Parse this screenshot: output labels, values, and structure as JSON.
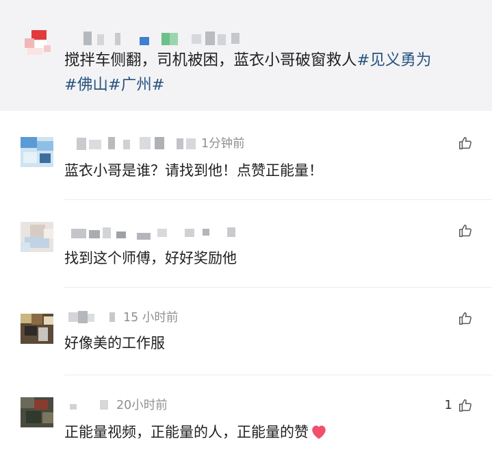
{
  "post": {
    "text_plain": "搅拌车侧翻，司机被困，蓝衣小哥破窗救人",
    "hashtags": [
      "#见义勇为",
      "#佛山",
      "#广州",
      "#"
    ]
  },
  "comments": [
    {
      "time": "1分钟前",
      "text": "蓝衣小哥是谁？请找到他！点赞正能量！",
      "likes": ""
    },
    {
      "time": "",
      "text": "找到这个师傅，好好奖励他",
      "likes": ""
    },
    {
      "time": "15 小时前",
      "text": "好像美的工作服",
      "likes": ""
    },
    {
      "time": "20小时前",
      "text": "正能量视频，正能量的人，正能量的赞",
      "likes": "1"
    }
  ],
  "icons": {
    "like": "thumbs-up-icon",
    "heart": "heart-icon"
  },
  "colors": {
    "hashtag": "#27527f",
    "heart": "#f0506e",
    "post_bg": "#f3f3f5"
  }
}
